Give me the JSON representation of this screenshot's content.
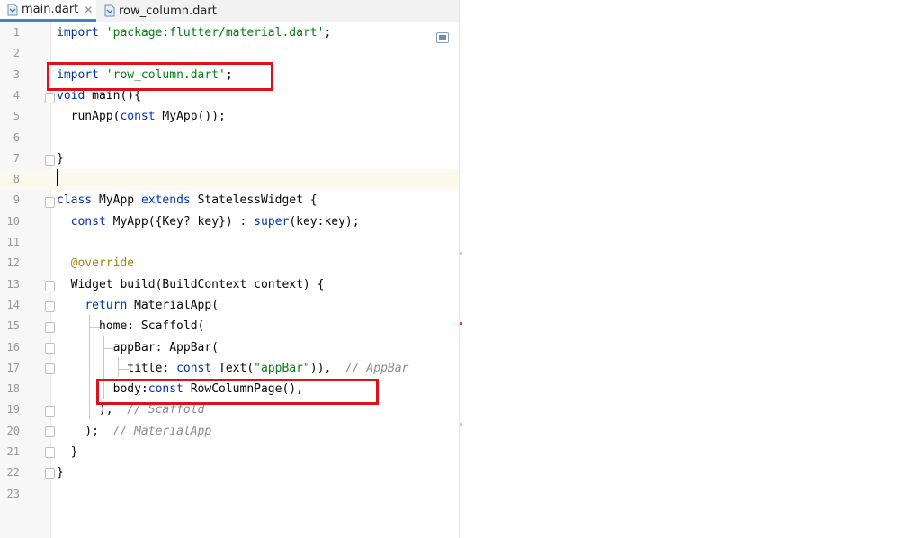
{
  "tabs": [
    {
      "label": "main.dart",
      "active": true,
      "icon": "dart-file-icon"
    },
    {
      "label": "row_column.dart",
      "active": false,
      "icon": "dart-file-icon"
    }
  ],
  "colors": {
    "keyword": "#0033b3",
    "string": "#067d17",
    "comment": "#8c8c8c",
    "annotation": "#9e880d",
    "highlight_box": "#e0101a",
    "active_tab_underline": "#4083c9"
  },
  "editor": {
    "current_line": 8,
    "highlighted_lines": [
      3,
      18
    ],
    "lines": [
      {
        "n": "1",
        "tokens": [
          {
            "t": "import ",
            "c": "kw"
          },
          {
            "t": "'package:flutter/material.dart'",
            "c": "str"
          },
          {
            "t": ";",
            "c": ""
          }
        ]
      },
      {
        "n": "2",
        "tokens": []
      },
      {
        "n": "3",
        "tokens": [
          {
            "t": "import ",
            "c": "kw"
          },
          {
            "t": "'row_column.dart'",
            "c": "str"
          },
          {
            "t": ";",
            "c": ""
          }
        ]
      },
      {
        "n": "4",
        "tokens": [
          {
            "t": "void ",
            "c": "kw"
          },
          {
            "t": "main(){",
            "c": ""
          }
        ]
      },
      {
        "n": "5",
        "tokens": [
          {
            "t": "  runApp(",
            "c": ""
          },
          {
            "t": "const ",
            "c": "kw"
          },
          {
            "t": "MyApp());",
            "c": ""
          }
        ]
      },
      {
        "n": "6",
        "tokens": []
      },
      {
        "n": "7",
        "tokens": [
          {
            "t": "}",
            "c": ""
          }
        ]
      },
      {
        "n": "8",
        "tokens": []
      },
      {
        "n": "9",
        "tokens": [
          {
            "t": "class ",
            "c": "kw"
          },
          {
            "t": "MyApp ",
            "c": ""
          },
          {
            "t": "extends ",
            "c": "kw"
          },
          {
            "t": "StatelessWidget {",
            "c": ""
          }
        ]
      },
      {
        "n": "10",
        "tokens": [
          {
            "t": "  ",
            "c": ""
          },
          {
            "t": "const ",
            "c": "kw"
          },
          {
            "t": "MyApp({Key? key}) : ",
            "c": ""
          },
          {
            "t": "super",
            "c": "kw"
          },
          {
            "t": "(key:key);",
            "c": ""
          }
        ]
      },
      {
        "n": "11",
        "tokens": []
      },
      {
        "n": "12",
        "tokens": [
          {
            "t": "  @override",
            "c": "ann"
          }
        ]
      },
      {
        "n": "13",
        "tokens": [
          {
            "t": "  Widget build(BuildContext context) {",
            "c": ""
          }
        ]
      },
      {
        "n": "14",
        "tokens": [
          {
            "t": "    ",
            "c": ""
          },
          {
            "t": "return ",
            "c": "kw"
          },
          {
            "t": "MaterialApp(",
            "c": ""
          }
        ]
      },
      {
        "n": "15",
        "tokens": [
          {
            "t": "      home: Scaffold(",
            "c": ""
          }
        ]
      },
      {
        "n": "16",
        "tokens": [
          {
            "t": "        appBar: AppBar(",
            "c": ""
          }
        ]
      },
      {
        "n": "17",
        "tokens": [
          {
            "t": "          title: ",
            "c": ""
          },
          {
            "t": "const ",
            "c": "kw"
          },
          {
            "t": "Text(",
            "c": ""
          },
          {
            "t": "\"appBar\"",
            "c": "str"
          },
          {
            "t": ")),  ",
            "c": ""
          },
          {
            "t": "// AppBar",
            "c": "cm"
          }
        ]
      },
      {
        "n": "18",
        "tokens": [
          {
            "t": "        body:",
            "c": ""
          },
          {
            "t": "const ",
            "c": "kw"
          },
          {
            "t": "RowColumnPage(),",
            "c": ""
          }
        ]
      },
      {
        "n": "19",
        "tokens": [
          {
            "t": "      ),  ",
            "c": ""
          },
          {
            "t": "// Scaffold",
            "c": "cm"
          }
        ]
      },
      {
        "n": "20",
        "tokens": [
          {
            "t": "    );  ",
            "c": ""
          },
          {
            "t": "// MaterialApp",
            "c": "cm"
          }
        ]
      },
      {
        "n": "21",
        "tokens": [
          {
            "t": "  }",
            "c": ""
          }
        ]
      },
      {
        "n": "22",
        "tokens": [
          {
            "t": "}",
            "c": ""
          }
        ]
      },
      {
        "n": "23",
        "tokens": []
      }
    ]
  }
}
